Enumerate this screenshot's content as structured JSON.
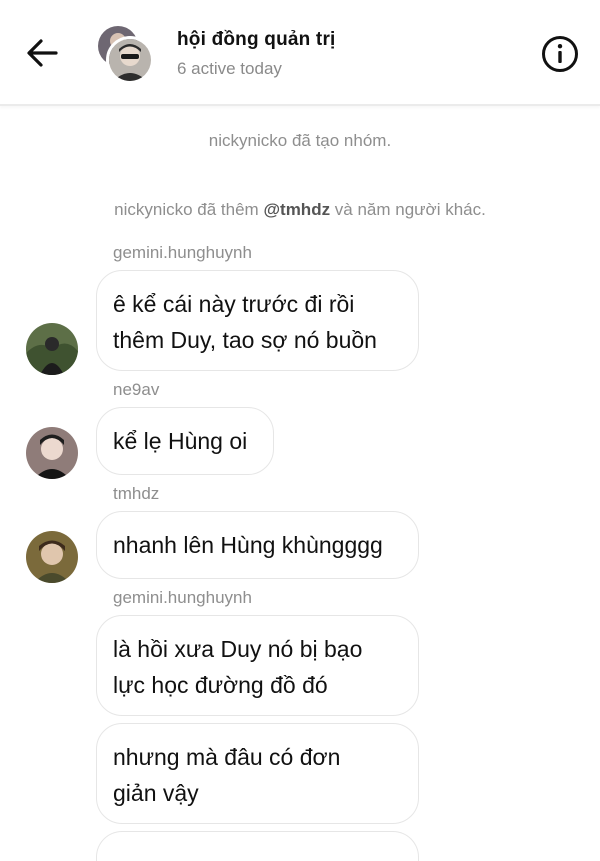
{
  "header": {
    "title": "hội đồng quản trị",
    "subtitle": "6 active today",
    "back_icon": "arrow-left-icon",
    "info_icon": "info-circle-icon"
  },
  "system_messages": [
    {
      "text": "nickynicko đã tạo nhóm."
    },
    {
      "pre": "nickynicko đã thêm ",
      "mention": "@tmhdz",
      "post": " và năm người khác."
    }
  ],
  "messages": [
    {
      "sender": "gemini.hunghuynh",
      "text": "ê kể cái này trước đi rồi\nthêm Duy, tao sợ nó buồn"
    },
    {
      "sender": "ne9av",
      "text": "kể lẹ Hùng oi"
    },
    {
      "sender": "tmhdz",
      "text": "nhanh lên Hùng khùngggg"
    },
    {
      "sender": "gemini.hunghuynh",
      "text": "là hồi xưa Duy nó bị bạo\nlực học đường đồ đó"
    },
    {
      "sender": "",
      "text": "nhưng mà đâu có đơn\ngiản vậy"
    },
    {
      "sender": "",
      "text": ""
    }
  ],
  "colors": {
    "border": "#e6e6e6",
    "muted": "#8e8e8e",
    "text": "#111111"
  }
}
